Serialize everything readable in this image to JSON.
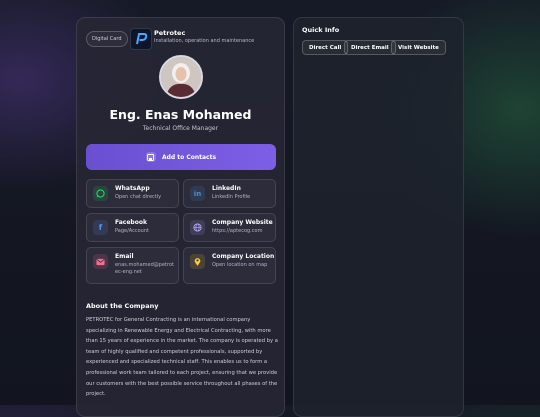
{
  "card": {
    "badge": "Digital Card",
    "brand": {
      "name": "Petrotec",
      "tagline": "Installation, operation and maintenance"
    },
    "name": "Eng. Enas Mohamed",
    "role": "Technical Office Manager",
    "add_contact": "Add to Contacts"
  },
  "contacts": [
    {
      "title": "WhatsApp",
      "subtitle": "Open chat directly",
      "icon": "whatsapp-icon",
      "color": "#25d366"
    },
    {
      "title": "LinkedIn",
      "subtitle": "LinkedIn Profile",
      "icon": "linkedin-icon",
      "color": "#4a8fd6"
    },
    {
      "title": "Facebook",
      "subtitle": "Page/Account",
      "icon": "facebook-icon",
      "color": "#5b8ff0"
    },
    {
      "title": "Company Website",
      "subtitle": "https://aptecog.com",
      "icon": "globe-icon",
      "color": "#b0a8ff"
    },
    {
      "title": "Email",
      "subtitle": "enas.mohamed@petrotec-eng.net",
      "icon": "mail-icon",
      "color": "#ff6b8a"
    },
    {
      "title": "Company Location",
      "subtitle": "Open location on map",
      "icon": "location-pin-icon",
      "color": "#ffcc33"
    }
  ],
  "about": {
    "title": "About the Company",
    "body": "PETROTEC for General Contracting is an international company specializing in Renewable Energy and Electrical Contracting, with more than 15 years of experience in the market. The company is operated by a team of highly qualified and competent professionals, supported by experienced and specialized technical staff. This enables us to form a professional work team tailored to each project, ensuring that we provide our customers with the best possible service throughout all phases of the project."
  },
  "quick_info": {
    "title": "Quick Info",
    "buttons": [
      "Direct Call",
      "Direct Email",
      "Visit Website"
    ]
  },
  "colors": {
    "accent": "#7b5ce6"
  }
}
